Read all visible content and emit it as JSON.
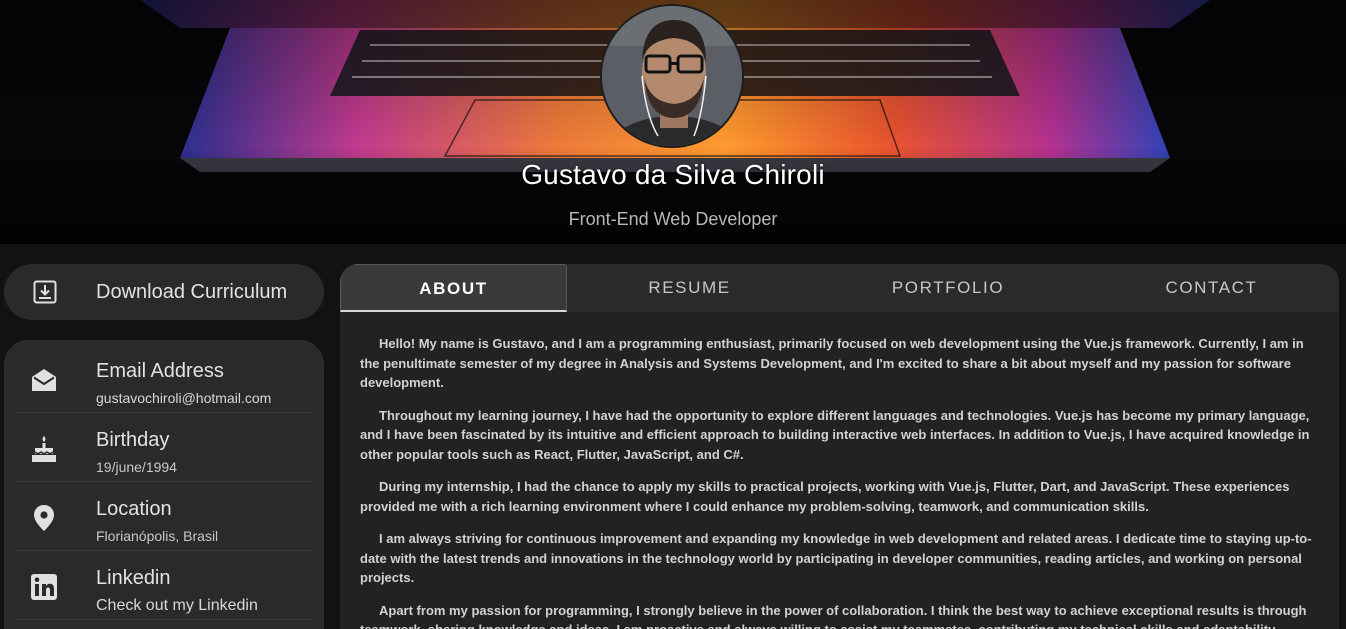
{
  "profile": {
    "name": "Gustavo da Silva Chiroli",
    "role": "Front-End Web Developer"
  },
  "sidebar": {
    "download": {
      "label": "Download Curriculum",
      "icon": "download-icon"
    },
    "items": [
      {
        "title": "Email Address",
        "value": "gustavochiroli@hotmail.com",
        "icon": "envelope-open-icon"
      },
      {
        "title": "Birthday",
        "value": "19/june/1994",
        "icon": "cake-icon"
      },
      {
        "title": "Location",
        "value": "Florianópolis, Brasil",
        "icon": "map-pin-icon"
      },
      {
        "title": "Linkedin",
        "value": "Check out my Linkedin",
        "icon": "linkedin-icon"
      }
    ]
  },
  "tabs": [
    {
      "label": "ABOUT",
      "active": true
    },
    {
      "label": "RESUME",
      "active": false
    },
    {
      "label": "PORTFOLIO",
      "active": false
    },
    {
      "label": "CONTACT",
      "active": false
    }
  ],
  "about": {
    "paragraphs": [
      "Hello! My name is Gustavo, and I am a programming enthusiast, primarily focused on web development using the Vue.js framework. Currently, I am in the penultimate semester of my degree in Analysis and Systems Development, and I'm excited to share a bit about myself and my passion for software development.",
      "Throughout my learning journey, I have had the opportunity to explore different languages and technologies. Vue.js has become my primary language, and I have been fascinated by its intuitive and efficient approach to building interactive web interfaces. In addition to Vue.js, I have acquired knowledge in other popular tools such as React, Flutter, JavaScript, and C#.",
      "During my internship, I had the chance to apply my skills to practical projects, working with Vue.js, Flutter, Dart, and JavaScript. These experiences provided me with a rich learning environment where I could enhance my problem-solving, teamwork, and communication skills.",
      "I am always striving for continuous improvement and expanding my knowledge in web development and related areas. I dedicate time to staying up-to-date with the latest trends and innovations in the technology world by participating in developer communities, reading articles, and working on personal projects.",
      "Apart from my passion for programming, I strongly believe in the power of collaboration. I think the best way to achieve exceptional results is through teamwork, sharing knowledge and ideas. I am proactive and always willing to assist my teammates, contributing my technical skills and adaptability."
    ]
  },
  "colors": {
    "page_bg": "#121212",
    "card_bg": "#2a2a2a",
    "panel_bg": "#222222",
    "accent_orange": "#ff7a1a",
    "accent_magenta": "#c8378c",
    "accent_blue": "#3c6ee0"
  }
}
